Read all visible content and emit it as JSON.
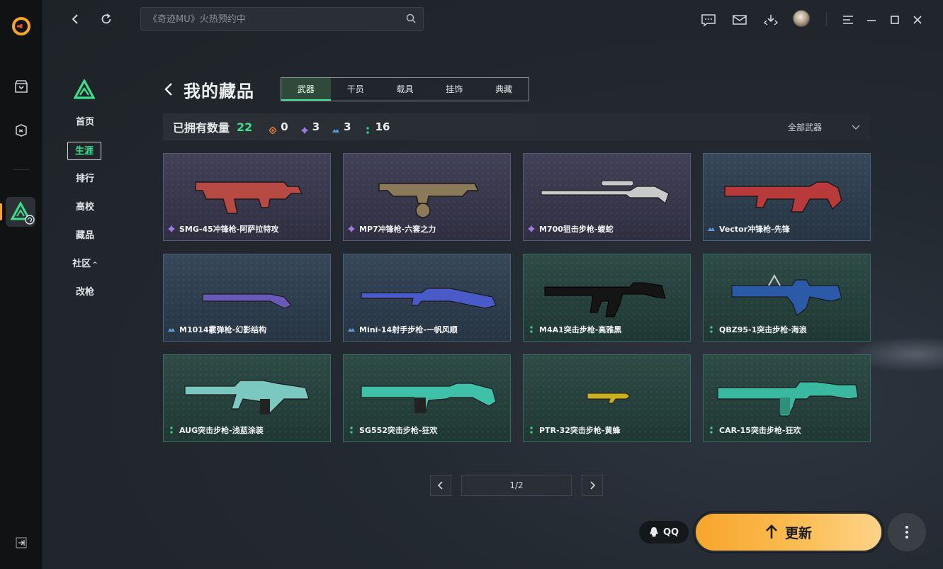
{
  "search": {
    "placeholder": "《奇迹MU》火热预约中"
  },
  "subnav": {
    "items": [
      {
        "label": "首页",
        "active": false
      },
      {
        "label": "生涯",
        "active": true
      },
      {
        "label": "排行",
        "active": false
      },
      {
        "label": "高校",
        "active": false
      },
      {
        "label": "藏品",
        "active": false
      },
      {
        "label": "社区",
        "active": false,
        "caret": "^"
      },
      {
        "label": "改枪",
        "active": false
      }
    ]
  },
  "page": {
    "title": "我的藏品"
  },
  "tabs": [
    {
      "label": "武器",
      "active": true
    },
    {
      "label": "干员",
      "active": false
    },
    {
      "label": "载具",
      "active": false
    },
    {
      "label": "挂饰",
      "active": false
    },
    {
      "label": "典藏",
      "active": false
    }
  ],
  "stats": {
    "label": "已拥有数量",
    "total": "22",
    "counts": [
      {
        "rarity": "orange",
        "color": "#e07b3a",
        "value": "0"
      },
      {
        "rarity": "purple",
        "color": "#a277e8",
        "value": "3"
      },
      {
        "rarity": "blue",
        "color": "#5b9be0",
        "value": "3"
      },
      {
        "rarity": "green",
        "color": "#3fd08e",
        "value": "16"
      }
    ],
    "filter": "全部武器"
  },
  "items": [
    {
      "name": "SMG-45冲锋枪-阿萨拉特攻",
      "rarity": "purple",
      "gun_color": "#b84a44"
    },
    {
      "name": "MP7冲锋枪-六套之力",
      "rarity": "purple",
      "gun_color": "#8a7a5a"
    },
    {
      "name": "M700狙击步枪-蝮蛇",
      "rarity": "purple",
      "gun_color": "#c9c9c9"
    },
    {
      "name": "Vector冲锋枪-先锋",
      "rarity": "blue",
      "gun_color": "#b83a3a"
    },
    {
      "name": "M1014霰弹枪-幻影结构",
      "rarity": "blue",
      "gun_color": "#6a5ab8"
    },
    {
      "name": "Mini-14射手步枪-一帆风顺",
      "rarity": "blue",
      "gun_color": "#4a5ac8"
    },
    {
      "name": "M4A1突击步枪-高雅黑",
      "rarity": "green",
      "gun_color": "#151515"
    },
    {
      "name": "QBZ95-1突击步枪-海浪",
      "rarity": "green",
      "gun_color": "#2a5aa8"
    },
    {
      "name": "AUG突击步枪-浅蓝涂装",
      "rarity": "green",
      "gun_color": "#7ac8c0"
    },
    {
      "name": "SG552突击步枪-狂欢",
      "rarity": "green",
      "gun_color": "#3fc0a8"
    },
    {
      "name": "PTR-32突击步枪-黄蜂",
      "rarity": "green",
      "gun_color": "#c8b020"
    },
    {
      "name": "CAR-15突击步枪-狂欢",
      "rarity": "green",
      "gun_color": "#3ab8a0"
    }
  ],
  "pager": {
    "text": "1/2"
  },
  "actions": {
    "qq_label": "QQ",
    "update_label": "更新"
  },
  "colors": {
    "accent_green": "#3fe08e",
    "update_orange": "#f7a52c",
    "rarity_purple": "#a277e8",
    "rarity_blue": "#5b9be0",
    "rarity_green": "#3fd08e"
  },
  "icons": [
    "app-logo-icon",
    "store-icon",
    "game-pad-icon",
    "delta-force-icon",
    "collapse-icon",
    "back-icon",
    "refresh-icon",
    "search-icon",
    "chat-icon",
    "mail-icon",
    "download-icon",
    "menu-icon",
    "minimize-icon",
    "maximize-icon",
    "close-icon",
    "chevron-down-icon",
    "chevron-left-icon",
    "chevron-right-icon",
    "qq-icon",
    "arrow-up-icon",
    "more-vertical-icon"
  ]
}
